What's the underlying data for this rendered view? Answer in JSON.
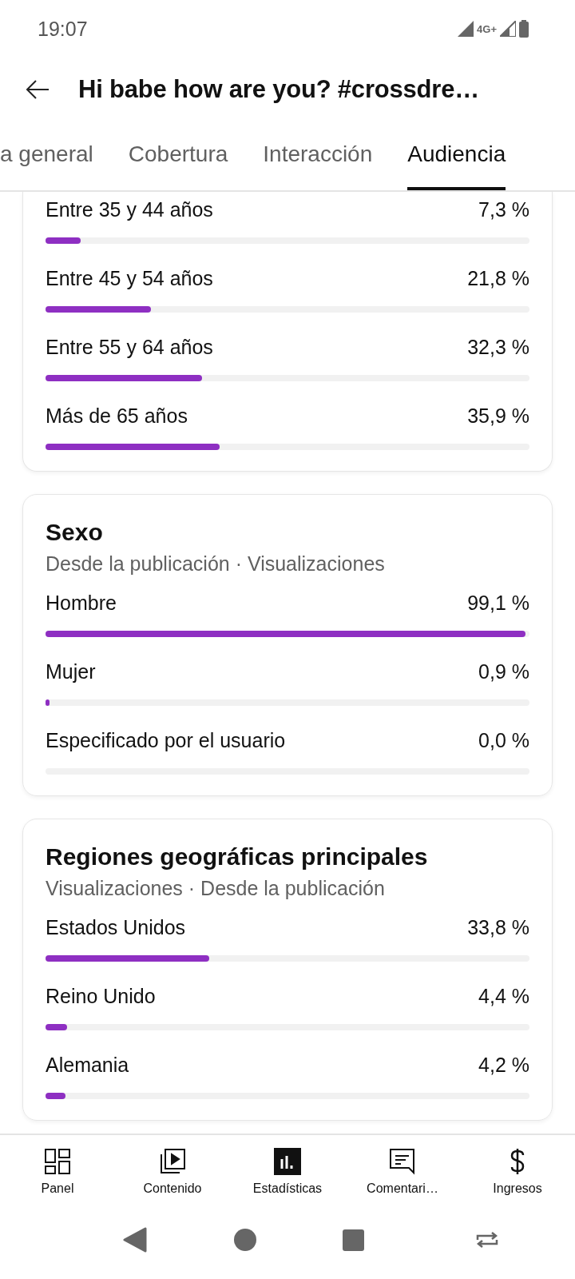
{
  "status_bar": {
    "time": "19:07",
    "network": "4G+"
  },
  "header": {
    "title": "Hi babe how are you? #crossdre…"
  },
  "tabs": [
    {
      "label": "a general",
      "selected": false
    },
    {
      "label": "Cobertura",
      "selected": false
    },
    {
      "label": "Interacción",
      "selected": false
    },
    {
      "label": "Audiencia",
      "selected": true
    }
  ],
  "cards": [
    {
      "rows": [
        {
          "label": "Entre 35 y 44 años",
          "value": "7,3 %",
          "level": 0.073
        },
        {
          "label": "Entre 45 y 54 años",
          "value": "21,8 %",
          "level": 0.218
        },
        {
          "label": "Entre 55 y 64 años",
          "value": "32,3 %",
          "level": 0.323
        },
        {
          "label": "Más de 65 años",
          "value": "35,9 %",
          "level": 0.359
        }
      ]
    },
    {
      "title": "Sexo",
      "subtitle": "Desde la publicación · Visualizaciones",
      "rows": [
        {
          "label": "Hombre",
          "value": "99,1 %",
          "level": 0.991
        },
        {
          "label": "Mujer",
          "value": "0,9 %",
          "level": 0.009
        },
        {
          "label": "Especificado por el usuario",
          "value": "0,0 %",
          "level": 0
        }
      ]
    },
    {
      "title": "Regiones geográficas principales",
      "subtitle": "Visualizaciones · Desde la publicación",
      "rows": [
        {
          "label": "Estados Unidos",
          "value": "33,8 %",
          "level": 0.338
        },
        {
          "label": "Reino Unido",
          "value": "4,4 %",
          "level": 0.044
        },
        {
          "label": "Alemania",
          "value": "4,2 %",
          "level": 0.042
        }
      ]
    }
  ],
  "bottom_nav": [
    {
      "kind": "panel",
      "label": "Panel",
      "selected": false
    },
    {
      "kind": "content",
      "label": "Contenido",
      "selected": false
    },
    {
      "kind": "stats",
      "label": "Estadísticas",
      "selected": true
    },
    {
      "kind": "comments",
      "label": "Comentari…",
      "selected": false
    },
    {
      "kind": "money",
      "label": "Ingresos",
      "selected": false
    }
  ]
}
